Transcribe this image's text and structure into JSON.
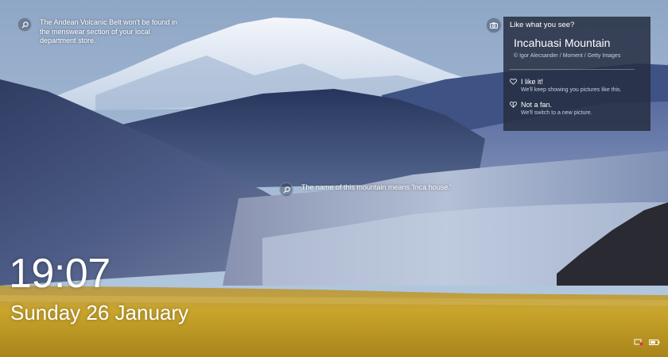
{
  "hints": [
    {
      "text": "The Andean Volcanic Belt won't be found in the menswear section of your local department store."
    },
    {
      "text": "The name of this mountain means 'Inca house.'"
    }
  ],
  "panel": {
    "heading": "Like what you see?",
    "title": "Incahuasi Mountain",
    "credit": "© Igor Alecsander / Moment / Getty Images",
    "options": [
      {
        "label": "I like it!",
        "sub": "We'll keep showing you pictures like this.",
        "icon": "heart-icon"
      },
      {
        "label": "Not a fan.",
        "sub": "We'll switch to a new picture.",
        "icon": "broken-heart-icon"
      }
    ]
  },
  "clock": {
    "time": "19:07",
    "date": "Sunday 26 January"
  },
  "status": {
    "icons": [
      "network-icon",
      "battery-icon"
    ]
  },
  "colors": {
    "panel_bg": "#262e42",
    "text": "#ffffff",
    "sky": "#7e9cc2",
    "grass": "#c8a42a"
  }
}
